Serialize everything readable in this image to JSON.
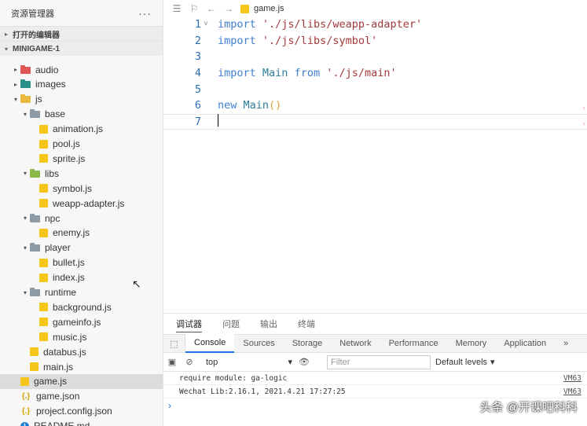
{
  "sidebar": {
    "title": "资源管理器",
    "more": "···",
    "open_editors": "打开的编辑器",
    "project": "MINIGAME-1",
    "tree": [
      {
        "label": "audio",
        "depth": 0,
        "type": "folder",
        "color": "red",
        "caret": "▸"
      },
      {
        "label": "images",
        "depth": 0,
        "type": "folder",
        "color": "teal",
        "caret": "▸"
      },
      {
        "label": "js",
        "depth": 0,
        "type": "folder",
        "color": "yellow",
        "caret": "▾"
      },
      {
        "label": "base",
        "depth": 1,
        "type": "folder",
        "color": "gray",
        "caret": "▾"
      },
      {
        "label": "animation.js",
        "depth": 2,
        "type": "js"
      },
      {
        "label": "pool.js",
        "depth": 2,
        "type": "js"
      },
      {
        "label": "sprite.js",
        "depth": 2,
        "type": "js"
      },
      {
        "label": "libs",
        "depth": 1,
        "type": "folder",
        "color": "green",
        "caret": "▾"
      },
      {
        "label": "symbol.js",
        "depth": 2,
        "type": "js"
      },
      {
        "label": "weapp-adapter.js",
        "depth": 2,
        "type": "js"
      },
      {
        "label": "npc",
        "depth": 1,
        "type": "folder",
        "color": "gray",
        "caret": "▾"
      },
      {
        "label": "enemy.js",
        "depth": 2,
        "type": "js"
      },
      {
        "label": "player",
        "depth": 1,
        "type": "folder",
        "color": "gray",
        "caret": "▾"
      },
      {
        "label": "bullet.js",
        "depth": 2,
        "type": "js"
      },
      {
        "label": "index.js",
        "depth": 2,
        "type": "js"
      },
      {
        "label": "runtime",
        "depth": 1,
        "type": "folder",
        "color": "gray",
        "caret": "▾"
      },
      {
        "label": "background.js",
        "depth": 2,
        "type": "js"
      },
      {
        "label": "gameinfo.js",
        "depth": 2,
        "type": "js"
      },
      {
        "label": "music.js",
        "depth": 2,
        "type": "js"
      },
      {
        "label": "databus.js",
        "depth": 1,
        "type": "js"
      },
      {
        "label": "main.js",
        "depth": 1,
        "type": "js"
      },
      {
        "label": "game.js",
        "depth": 0,
        "type": "js",
        "selected": true
      },
      {
        "label": "game.json",
        "depth": 0,
        "type": "json"
      },
      {
        "label": "project.config.json",
        "depth": 0,
        "type": "json"
      },
      {
        "label": "README.md",
        "depth": 0,
        "type": "info"
      }
    ]
  },
  "editor": {
    "filename": "game.js",
    "toolbar_icons": [
      "list-icon",
      "bookmark-icon",
      "back-arrow-icon",
      "forward-arrow-icon"
    ],
    "lines": [
      {
        "n": "1",
        "fold": "˅",
        "tokens": [
          {
            "t": "import",
            "c": "kw"
          },
          {
            "t": " ",
            "c": ""
          },
          {
            "t": "'./js/libs/weapp-adapter'",
            "c": "str"
          }
        ]
      },
      {
        "n": "2",
        "fold": "",
        "tokens": [
          {
            "t": "import",
            "c": "kw"
          },
          {
            "t": " ",
            "c": ""
          },
          {
            "t": "'./js/libs/symbol'",
            "c": "str"
          }
        ]
      },
      {
        "n": "3",
        "fold": "",
        "tokens": []
      },
      {
        "n": "4",
        "fold": "",
        "tokens": [
          {
            "t": "import",
            "c": "kw"
          },
          {
            "t": " ",
            "c": ""
          },
          {
            "t": "Main",
            "c": "cls"
          },
          {
            "t": " ",
            "c": ""
          },
          {
            "t": "from",
            "c": "kw"
          },
          {
            "t": " ",
            "c": ""
          },
          {
            "t": "'./js/main'",
            "c": "str"
          }
        ]
      },
      {
        "n": "5",
        "fold": "",
        "tokens": []
      },
      {
        "n": "6",
        "fold": "",
        "tokens": [
          {
            "t": "new",
            "c": "kw"
          },
          {
            "t": " ",
            "c": ""
          },
          {
            "t": "Main",
            "c": "fn"
          },
          {
            "t": "()",
            "c": "paren"
          }
        ]
      },
      {
        "n": "7",
        "fold": "",
        "tokens": [],
        "current": true
      }
    ]
  },
  "panel": {
    "tabs": [
      {
        "label": "调试器",
        "active": true
      },
      {
        "label": "问题",
        "active": false
      },
      {
        "label": "输出",
        "active": false
      },
      {
        "label": "终端",
        "active": false
      }
    ],
    "devtools_tabs": [
      {
        "label": "Console",
        "active": true
      },
      {
        "label": "Sources"
      },
      {
        "label": "Storage"
      },
      {
        "label": "Network"
      },
      {
        "label": "Performance"
      },
      {
        "label": "Memory"
      },
      {
        "label": "Application"
      },
      {
        "label": "»"
      }
    ],
    "context": "top",
    "filter_placeholder": "Filter",
    "levels": "Default levels",
    "logs": [
      {
        "text": "require module: ga-logic",
        "src": "VM63"
      },
      {
        "text": "Wechat Lib:2.16.1, 2021.4.21 17:27:25",
        "src": "VM63"
      }
    ],
    "prompt": "›"
  },
  "watermark": "头条 @开课吧科科"
}
